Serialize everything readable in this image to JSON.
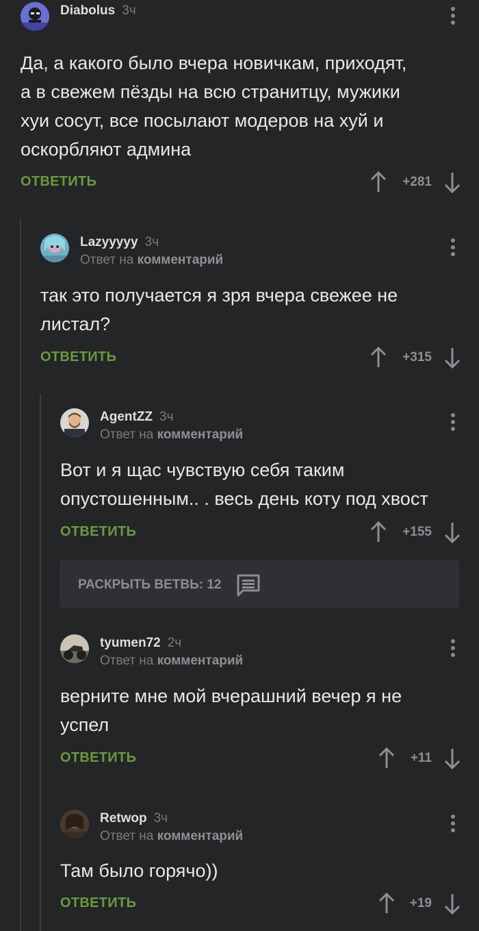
{
  "colors": {
    "background": "#242527",
    "reply": "#6b9a3e",
    "muted": "#7a7b7e"
  },
  "branch": {
    "label": "РАСКРЫТЬ ВЕТВЬ: 12",
    "icon": "comments-icon"
  },
  "comments": [
    {
      "author": "Diabolus",
      "time": "3ч",
      "reply_prefix": "",
      "reply_target": "",
      "lines": [
        "Да, а какого было вчера новичкам, приходят,",
        "а в свежем пёзды на всю странитцу, мужики",
        "хуи сосут, все посылают модеров на хуй и",
        "оскорбляют админа"
      ],
      "reply_label": "ОТВЕТИТЬ",
      "score": "+281"
    },
    {
      "author": "Lazyyyyy",
      "time": "3ч",
      "reply_prefix": "Ответ на",
      "reply_target": "комментарий",
      "lines": [
        "так это получается я зря вчера свежее не",
        "листал?"
      ],
      "reply_label": "ОТВЕТИТЬ",
      "score": "+315"
    },
    {
      "author": "AgentZZ",
      "time": "3ч",
      "reply_prefix": "Ответ на",
      "reply_target": "комментарий",
      "lines": [
        "Вот и я щас чувствую себя таким",
        "опустошенным.. . весь день коту под хвост"
      ],
      "reply_label": "ОТВЕТИТЬ",
      "score": "+155"
    },
    {
      "author": "tyumen72",
      "time": "2ч",
      "reply_prefix": "Ответ на",
      "reply_target": "комментарий",
      "lines": [
        "верните мне мой вчерашний вечер я не",
        "успел"
      ],
      "reply_label": "ОТВЕТИТЬ",
      "score": "+11"
    },
    {
      "author": "Retwop",
      "time": "3ч",
      "reply_prefix": "Ответ на",
      "reply_target": "комментарий",
      "lines": [
        "Там было горячо))"
      ],
      "reply_label": "ОТВЕТИТЬ",
      "score": "+19"
    }
  ]
}
